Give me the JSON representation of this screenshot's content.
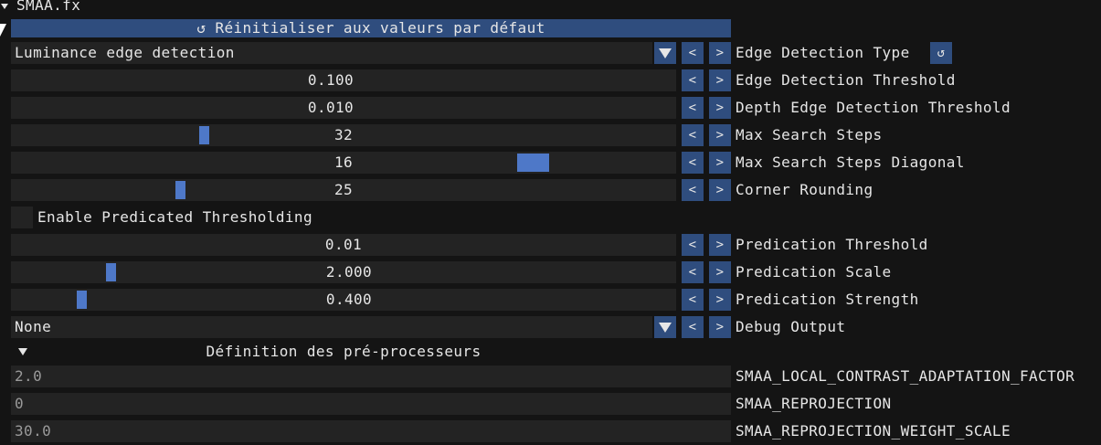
{
  "header": {
    "title": "SMAA.fx"
  },
  "reset_button": {
    "label": "Réinitialiser aux valeurs par défaut"
  },
  "buttons": {
    "prev": "<",
    "next": ">"
  },
  "edge_type": {
    "value": "Luminance edge detection",
    "label": "Edge Detection Type"
  },
  "edge_threshold": {
    "value": "0.100",
    "label": "Edge Detection Threshold"
  },
  "depth_threshold": {
    "value": "0.010",
    "label": "Depth Edge Detection Threshold"
  },
  "max_search_steps": {
    "value": "32",
    "label": "Max Search Steps"
  },
  "max_search_steps_diag": {
    "value": "16",
    "label": "Max Search Steps Diagonal"
  },
  "corner_rounding": {
    "value": "25",
    "label": "Corner Rounding"
  },
  "predicated": {
    "label": "Enable Predicated Thresholding"
  },
  "predication_threshold": {
    "value": "0.01",
    "label": "Predication Threshold"
  },
  "predication_scale": {
    "value": "2.000",
    "label": "Predication Scale"
  },
  "predication_strength": {
    "value": "0.400",
    "label": "Predication Strength"
  },
  "debug_output": {
    "value": "None",
    "label": "Debug Output"
  },
  "preprocessor": {
    "title": "Définition des pré-processeurs",
    "items": [
      {
        "value": "2.0",
        "label": "SMAA_LOCAL_CONTRAST_ADAPTATION_FACTOR"
      },
      {
        "value": "0",
        "label": "SMAA_REPROJECTION"
      },
      {
        "value": "30.0",
        "label": "SMAA_REPROJECTION_WEIGHT_SCALE"
      }
    ]
  },
  "colors": {
    "accent": "#4e78c8",
    "button": "#2f4d7e",
    "frame": "#232323",
    "background": "#141414"
  }
}
